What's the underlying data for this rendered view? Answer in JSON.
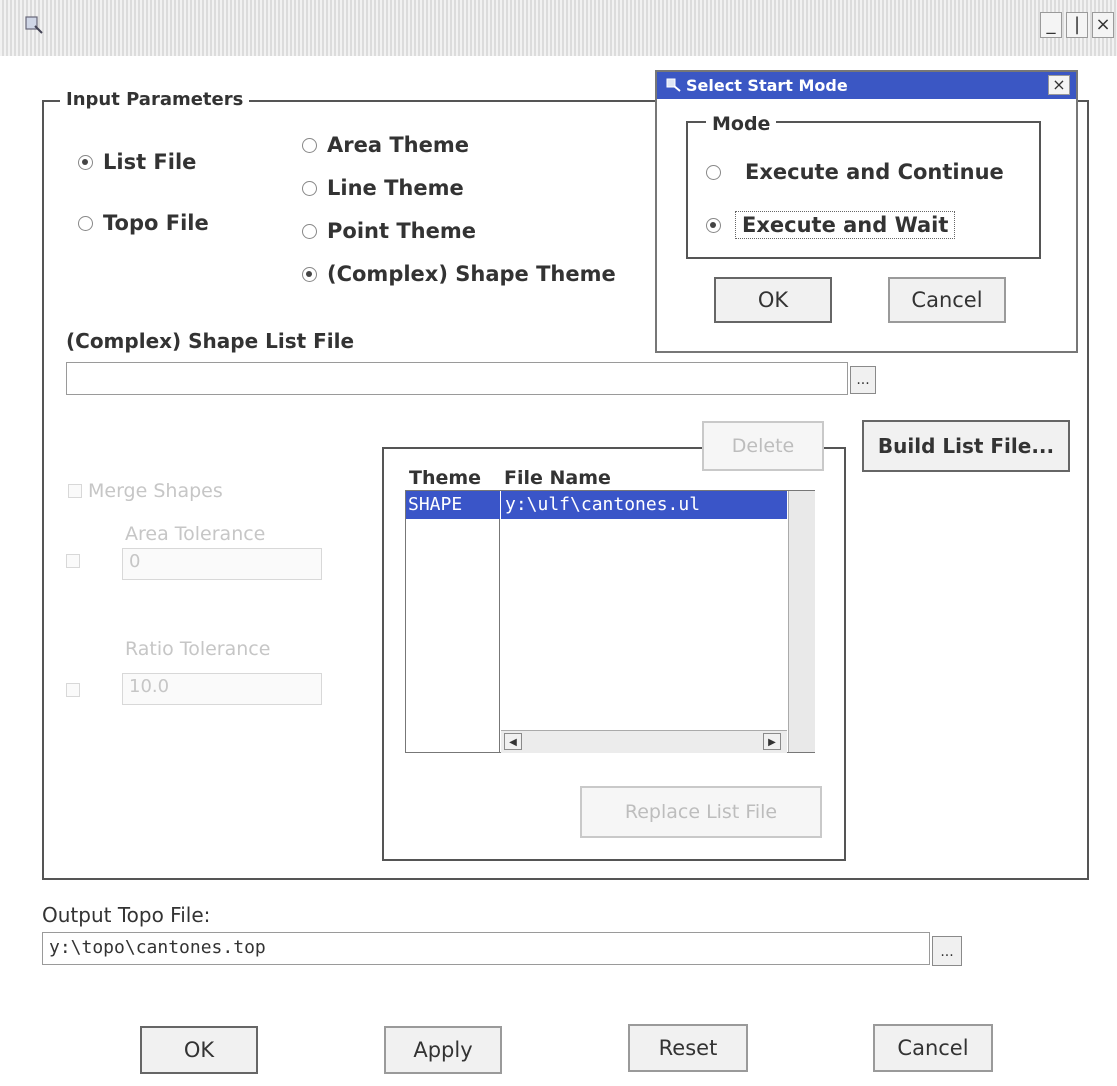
{
  "window": {
    "icon": "app-icon",
    "minimize": "_",
    "maximize": "|",
    "close": "×"
  },
  "input_parameters": {
    "legend": "Input Parameters",
    "source": [
      {
        "label": "List File",
        "selected": true
      },
      {
        "label": "Topo File",
        "selected": false
      }
    ],
    "themes": [
      {
        "label": "Area Theme",
        "selected": false
      },
      {
        "label": "Line Theme",
        "selected": false
      },
      {
        "label": "Point Theme",
        "selected": false
      },
      {
        "label": "(Complex) Shape Theme",
        "selected": true
      }
    ],
    "list_file_label": "(Complex) Shape List File",
    "list_file_value": "",
    "browse_label": "...",
    "build_list_label": "Build List File...",
    "delete_label": "Delete",
    "merge_label": "Merge Shapes",
    "area_tolerance_label": "Area Tolerance",
    "area_tolerance_value": "0",
    "ratio_tolerance_label": "Ratio Tolerance",
    "ratio_tolerance_value": "10.0",
    "replace_label": "Replace List File"
  },
  "file_table": {
    "headers": [
      "Theme",
      "File Name"
    ],
    "rows": [
      {
        "theme": "SHAPE",
        "file": "y:\\ulf\\cantones.ul"
      }
    ],
    "scroll_left": "◀",
    "scroll_right": "▶"
  },
  "output": {
    "label": "Output Topo File:",
    "value": "y:\\topo\\cantones.top",
    "browse_label": "..."
  },
  "buttons": {
    "ok": "OK",
    "apply": "Apply",
    "reset": "Reset",
    "cancel": "Cancel"
  },
  "start_mode_dialog": {
    "title": "Select Start Mode",
    "close": "×",
    "mode_legend": "Mode",
    "options": [
      {
        "label": "Execute and Continue",
        "selected": false
      },
      {
        "label": "Execute and Wait",
        "selected": true
      }
    ],
    "ok": "OK",
    "cancel": "Cancel"
  },
  "colors": {
    "title_active": "#3b57c4",
    "selection": "#3a55c8",
    "frame": "#555555"
  }
}
